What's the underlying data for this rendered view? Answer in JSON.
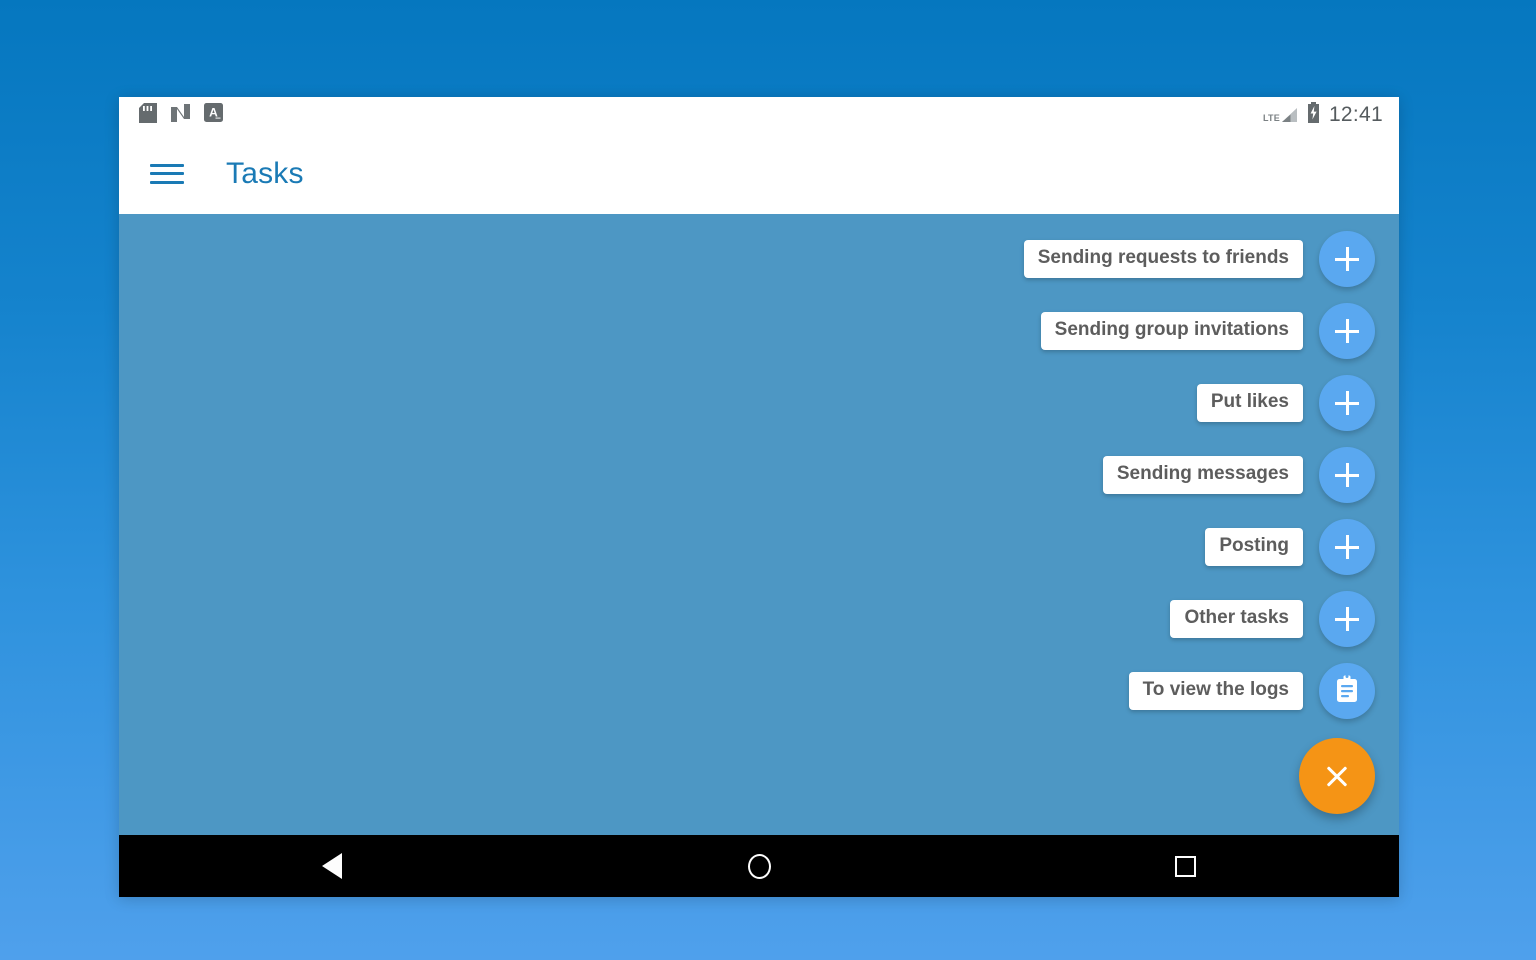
{
  "statusbar": {
    "icons": [
      "sd-card-icon",
      "nova-n-icon",
      "app-a-icon"
    ],
    "network_label": "LTE",
    "battery": "battery-charging-icon",
    "time": "12:41"
  },
  "appbar": {
    "menu_icon": "hamburger-menu-icon",
    "title": "Tasks"
  },
  "fab_menu": {
    "items": [
      {
        "label": "Sending requests to friends",
        "icon": "plus-icon"
      },
      {
        "label": "Sending group invitations",
        "icon": "plus-icon"
      },
      {
        "label": "Put likes",
        "icon": "plus-icon"
      },
      {
        "label": "Sending messages",
        "icon": "plus-icon"
      },
      {
        "label": "Posting",
        "icon": "plus-icon"
      },
      {
        "label": "Other tasks",
        "icon": "plus-icon"
      },
      {
        "label": "To view the logs",
        "icon": "clipboard-icon"
      }
    ],
    "main_fab_icon": "close-x-icon"
  },
  "navbar": {
    "back": "back-triangle-icon",
    "home": "home-circle-icon",
    "recents": "recents-square-icon"
  },
  "colors": {
    "accent_blue": "#1a7ab5",
    "mini_fab": "#5aa8f0",
    "main_fab": "#f59415",
    "scrim": "#4d97c4",
    "label_text": "#5d5d5d"
  }
}
